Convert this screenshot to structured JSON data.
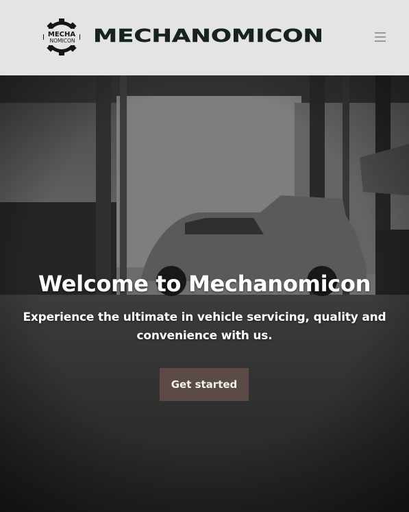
{
  "header": {
    "logo_line1": "MECHA",
    "logo_line2": "NOMICON",
    "brand_name": "MECHANOMICON",
    "menu_icon": "hamburger-icon"
  },
  "hero": {
    "title": "Welcome to Mechanomicon",
    "subtitle": "Experience the ultimate in vehicle servicing, quality and convenience with us.",
    "cta_label": "Get started",
    "background_image": "garage-photo"
  },
  "colors": {
    "header_bg": "#e4e4e4",
    "brand_dark_green": "#16241c",
    "cta_bg": "#5c4a46",
    "hero_text": "#ffffff",
    "menu_icon": "#9a9a9a"
  }
}
